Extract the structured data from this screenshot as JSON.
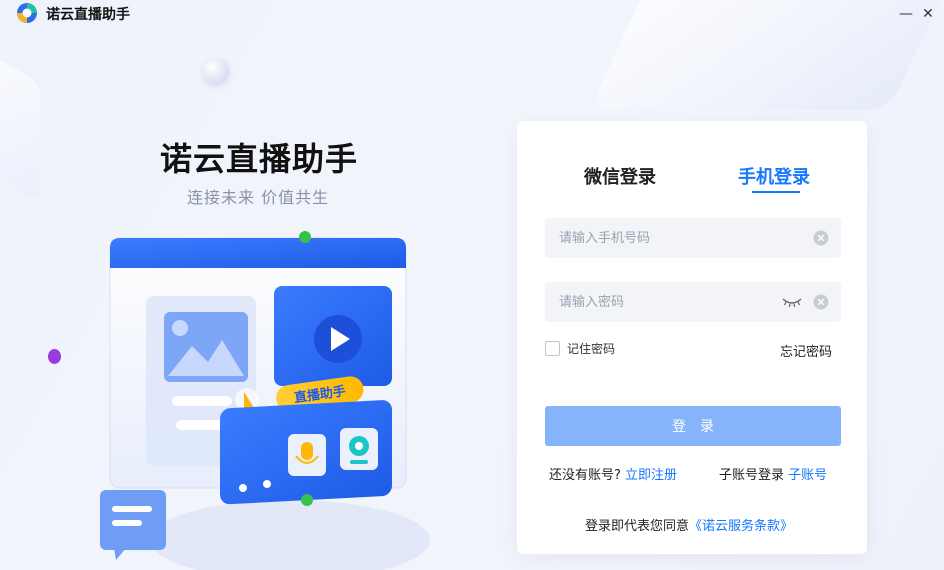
{
  "app": {
    "title": "诺云直播助手",
    "minimize_glyph": "—",
    "close_glyph": "✕"
  },
  "hero": {
    "title": "诺云直播助手",
    "subtitle": "连接未来 价值共生",
    "badge": "直播助手"
  },
  "tabs": {
    "wechat": "微信登录",
    "phone": "手机登录",
    "active": "phone"
  },
  "form": {
    "phone_placeholder": "请输入手机号码",
    "phone_value": "",
    "password_placeholder": "请输入密码",
    "password_value": "",
    "remember_label": "记住密码",
    "remember_checked": false,
    "forgot_label": "忘记密码",
    "login_label": "登录"
  },
  "footer": {
    "no_account_text": "还没有账号?",
    "register_link": "立即注册",
    "subaccount_text": "子账号登录",
    "subaccount_link": "子账号",
    "agree_text": "登录即代表您同意",
    "terms_link": "《诺云服务条款》"
  },
  "colors": {
    "accent": "#1677ff",
    "button_disabled": "#85b4fb",
    "header_blue": "#1e5be6"
  },
  "icons": [
    "app-logo-icon",
    "minimize-icon",
    "close-icon",
    "clear-icon",
    "eye-closed-icon",
    "play-icon",
    "microphone-icon",
    "camera-icon",
    "cursor-icon",
    "image-icon",
    "chat-bubble-icon"
  ]
}
